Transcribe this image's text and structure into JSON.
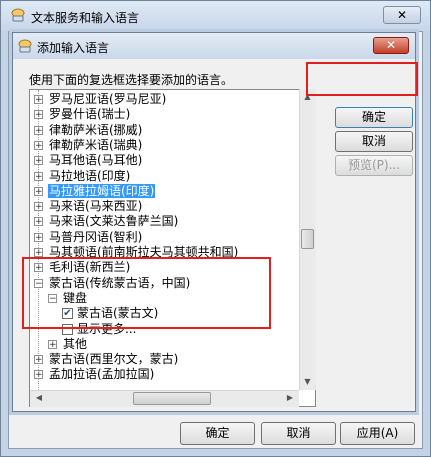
{
  "outer_window": {
    "title": "文本服务和输入语言",
    "close_glyph": "✕",
    "buttons": {
      "ok": "确定",
      "cancel": "取消",
      "apply": "应用(A)"
    }
  },
  "dialog": {
    "title": "添加输入语言",
    "close_glyph": "✕",
    "instruction": "使用下面的复选框选择要添加的语言。",
    "buttons": {
      "ok": "确定",
      "cancel": "取消",
      "preview": "预览(P)..."
    }
  },
  "tree_items": [
    {
      "label": "罗马尼亚语(罗马尼亚)",
      "level": 0,
      "expander": "+"
    },
    {
      "label": "罗曼什语(瑞士)",
      "level": 0,
      "expander": "+"
    },
    {
      "label": "律勒萨米语(挪威)",
      "level": 0,
      "expander": "+"
    },
    {
      "label": "律勒萨米语(瑞典)",
      "level": 0,
      "expander": "+"
    },
    {
      "label": "马耳他语(马耳他)",
      "level": 0,
      "expander": "+"
    },
    {
      "label": "马拉地语(印度)",
      "level": 0,
      "expander": "+"
    },
    {
      "label": "马拉雅拉姆语(印度)",
      "level": 0,
      "expander": "+",
      "selected": true
    },
    {
      "label": "马来语(马来西亚)",
      "level": 0,
      "expander": "+"
    },
    {
      "label": "马来语(文莱达鲁萨兰国)",
      "level": 0,
      "expander": "+"
    },
    {
      "label": "马普丹冈语(智利)",
      "level": 0,
      "expander": "+"
    },
    {
      "label": "马其顿语(前南斯拉夫马其顿共和国)",
      "level": 0,
      "expander": "+"
    },
    {
      "label": "毛利语(新西兰)",
      "level": 0,
      "expander": "+"
    },
    {
      "label": "蒙古语(传统蒙古语，中国)",
      "level": 0,
      "expander": "−"
    },
    {
      "label": "键盘",
      "level": 1,
      "expander": "−"
    },
    {
      "label": "蒙古语(蒙古文)",
      "level": 2,
      "checked": true
    },
    {
      "label": "显示更多...",
      "level": 2,
      "checked": false
    },
    {
      "label": "其他",
      "level": 1,
      "expander": "+"
    },
    {
      "label": "蒙古语(西里尔文，蒙古)",
      "level": 0,
      "expander": "+"
    },
    {
      "label": "孟加拉语(孟加拉国)",
      "level": 0,
      "expander": "+"
    }
  ],
  "scrollbar": {
    "up": "▲",
    "down": "▼",
    "left": "◀",
    "right": "▶"
  },
  "colors": {
    "highlight": "#e02020",
    "selection": "#3399ff"
  }
}
